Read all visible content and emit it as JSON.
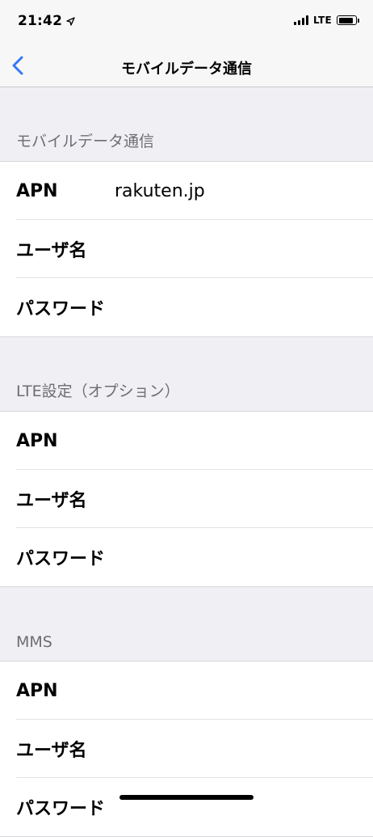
{
  "status_bar": {
    "time": "21:42",
    "network": "LTE",
    "battery_level": 0.85,
    "icons": [
      "location-arrow-icon",
      "cellular-signal-icon",
      "battery-icon"
    ]
  },
  "nav": {
    "back_icon": "chevron-left-icon",
    "title": "モバイルデータ通信"
  },
  "sections": [
    {
      "header": "モバイルデータ通信",
      "rows": [
        {
          "label": "APN",
          "value": "rakuten.jp"
        },
        {
          "label": "ユーザ名",
          "value": ""
        },
        {
          "label": "パスワード",
          "value": ""
        }
      ]
    },
    {
      "header": "LTE設定（オプション）",
      "rows": [
        {
          "label": "APN",
          "value": ""
        },
        {
          "label": "ユーザ名",
          "value": ""
        },
        {
          "label": "パスワード",
          "value": ""
        }
      ]
    },
    {
      "header": "MMS",
      "rows": [
        {
          "label": "APN",
          "value": ""
        },
        {
          "label": "ユーザ名",
          "value": ""
        },
        {
          "label": "パスワード",
          "value": ""
        }
      ]
    }
  ],
  "colors": {
    "accent": "#3478f6",
    "background": "#efeff4",
    "section_header_text": "#6d6d72"
  }
}
